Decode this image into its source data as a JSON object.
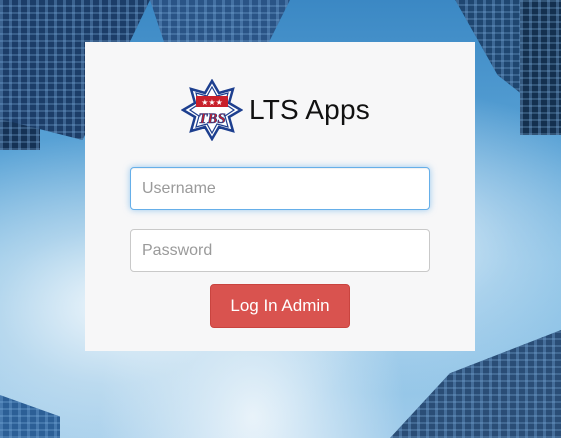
{
  "brand": {
    "title": "LTS Apps",
    "logo_text": "TBS",
    "logo_colors": {
      "star_outer": "#1d3f8f",
      "star_inner": "#ffffff",
      "band": "#c8202b",
      "stars": "#ffffff",
      "text": "#c8202b"
    }
  },
  "form": {
    "username_placeholder": "Username",
    "username_value": "",
    "password_placeholder": "Password",
    "password_value": "",
    "submit_label": "Log In Admin"
  },
  "colors": {
    "button_bg": "#d9534f",
    "focus_border": "#66afe9",
    "card_bg": "#f7f7f8"
  }
}
